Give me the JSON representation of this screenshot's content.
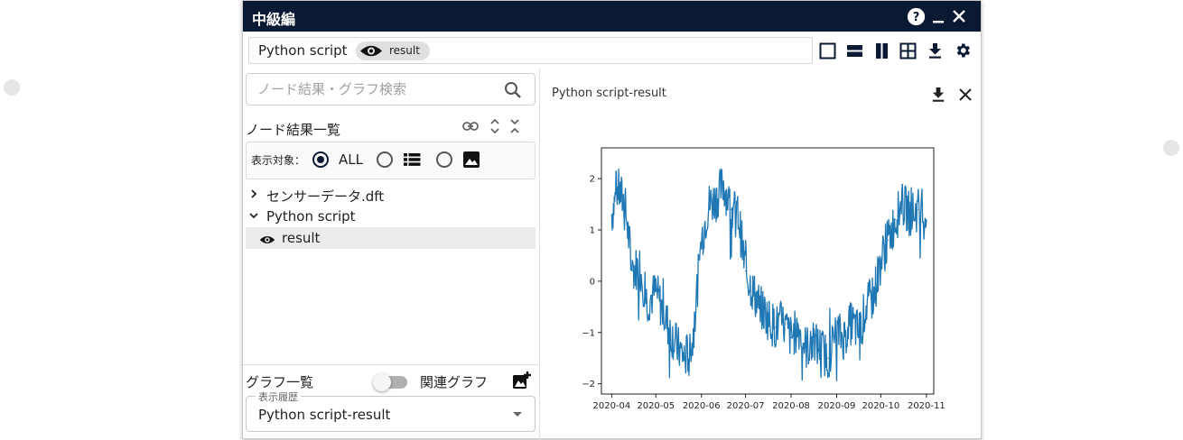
{
  "window": {
    "title": "中級編",
    "help_icon": "help-circle-icon",
    "minimize_icon": "minimize-icon",
    "close_icon": "close-icon"
  },
  "tabbar": {
    "name": "Python script",
    "chip_label": "result",
    "chip_icon": "eye-icon"
  },
  "layout_toolbar": [
    "single-layout-icon",
    "horizontal-split-icon",
    "vertical-split-icon",
    "grid-layout-icon",
    "download-icon",
    "gear-icon"
  ],
  "left": {
    "search_placeholder": "ノード結果・グラフ検索",
    "node_list_title": "ノード結果一覧",
    "filter_label": "表示対象：",
    "filter_all": "ALL",
    "tree": [
      {
        "label": "センサーデータ.dft",
        "expanded": false
      },
      {
        "label": "Python script",
        "expanded": true
      },
      {
        "label": "result",
        "selected": true
      }
    ],
    "graph_list_title": "グラフ一覧",
    "related_graph_label": "関連グラフ",
    "history_legend": "表示履歴",
    "history_value": "Python script-result"
  },
  "right": {
    "panel_title": "Python script-result"
  },
  "colors": {
    "titlebar": "#0b1a33",
    "series": "#1f77b4"
  },
  "chart_data": {
    "type": "line",
    "title": "",
    "xlabel": "",
    "ylabel": "",
    "grid": false,
    "x_ticks": [
      "2020-04",
      "2020-05",
      "2020-06",
      "2020-07",
      "2020-08",
      "2020-09",
      "2020-10",
      "2020-11"
    ],
    "y_ticks": [
      "2",
      "1",
      "0",
      "−1",
      "−2"
    ],
    "ylim": [
      -2.2,
      2.6
    ],
    "xlim": [
      "2020-03-25",
      "2020-11-06"
    ],
    "series": [
      {
        "x": [
          "2020-04-01",
          "2020-04-05",
          "2020-04-10",
          "2020-04-15",
          "2020-04-20",
          "2020-04-25",
          "2020-05-01",
          "2020-05-06",
          "2020-05-11",
          "2020-05-16",
          "2020-05-21",
          "2020-05-26",
          "2020-06-01",
          "2020-06-06",
          "2020-06-11",
          "2020-06-16",
          "2020-06-21",
          "2020-06-26",
          "2020-07-01",
          "2020-07-06",
          "2020-07-11",
          "2020-07-16",
          "2020-07-21",
          "2020-07-26",
          "2020-08-01",
          "2020-08-06",
          "2020-08-11",
          "2020-08-16",
          "2020-08-21",
          "2020-08-26",
          "2020-09-01",
          "2020-09-06",
          "2020-09-11",
          "2020-09-16",
          "2020-09-21",
          "2020-09-26",
          "2020-10-01",
          "2020-10-06",
          "2020-10-11",
          "2020-10-16",
          "2020-10-21",
          "2020-10-26",
          "2020-11-01"
        ],
        "values": [
          1.3,
          1.8,
          1.5,
          0.2,
          0.3,
          -0.4,
          -0.2,
          -0.6,
          -1.0,
          -1.3,
          -1.5,
          -1.2,
          0.8,
          1.5,
          1.6,
          1.9,
          1.4,
          1.3,
          0.2,
          -0.2,
          -0.5,
          -0.7,
          -0.9,
          -0.8,
          -1.1,
          -0.9,
          -1.3,
          -1.2,
          -1.3,
          -1.5,
          -1.0,
          -1.1,
          -0.8,
          -1.0,
          -0.5,
          -0.3,
          0.4,
          0.8,
          1.2,
          1.5,
          1.3,
          1.4,
          1.2
        ]
      }
    ]
  }
}
